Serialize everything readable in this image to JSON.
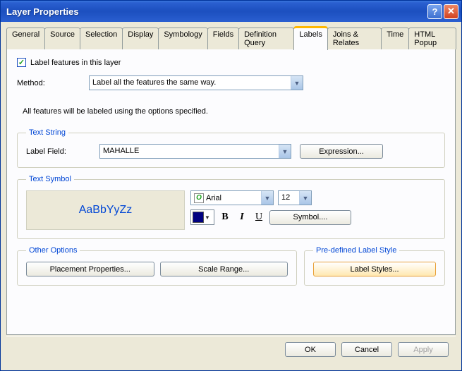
{
  "window": {
    "title": "Layer Properties"
  },
  "tabs": [
    "General",
    "Source",
    "Selection",
    "Display",
    "Symbology",
    "Fields",
    "Definition Query",
    "Labels",
    "Joins & Relates",
    "Time",
    "HTML Popup"
  ],
  "activeTab": "Labels",
  "labelFeatures": {
    "text": "Label features in this layer",
    "checked": true
  },
  "method": {
    "label": "Method:",
    "value": "Label all the features the same way."
  },
  "infoText": "All features will be labeled using the options specified.",
  "textString": {
    "legend": "Text String",
    "labelFieldLabel": "Label Field:",
    "labelFieldValue": "MAHALLE",
    "expressionBtn": "Expression..."
  },
  "textSymbol": {
    "legend": "Text Symbol",
    "preview": "AaBbYyZz",
    "fontName": "Arial",
    "fontSize": "12",
    "colorHex": "#000080",
    "bold": "B",
    "italic": "I",
    "underline": "U",
    "symbolBtn": "Symbol...."
  },
  "otherOptions": {
    "legend": "Other Options",
    "placementBtn": "Placement Properties...",
    "scaleBtn": "Scale Range..."
  },
  "preDefined": {
    "legend": "Pre-defined Label Style",
    "labelStylesBtn": "Label Styles..."
  },
  "footer": {
    "ok": "OK",
    "cancel": "Cancel",
    "apply": "Apply"
  }
}
